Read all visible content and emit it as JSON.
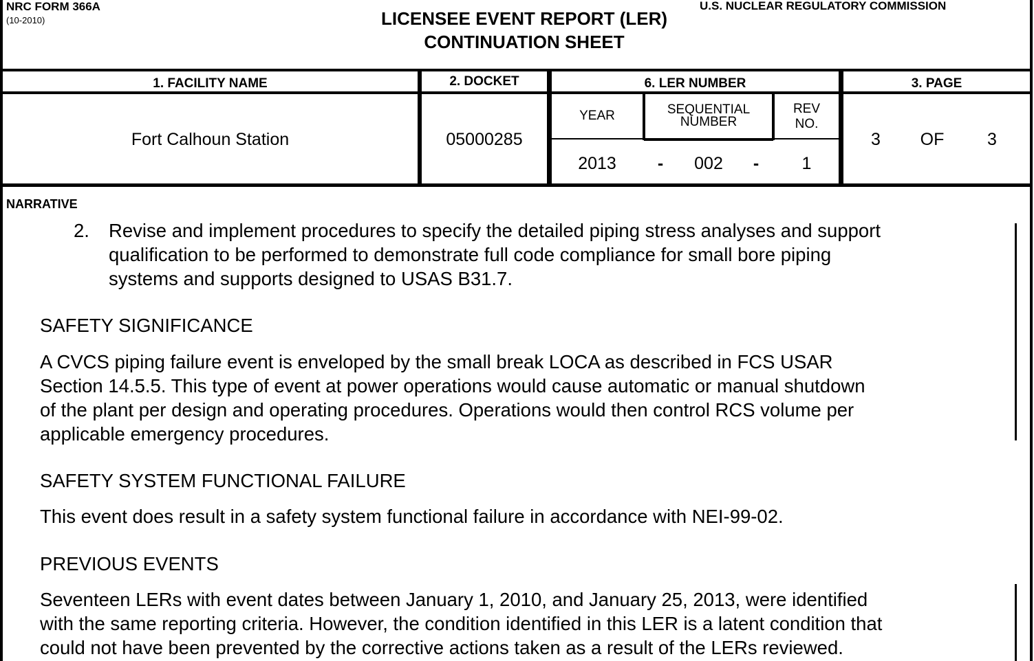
{
  "header": {
    "form_id": "NRC FORM 366A",
    "form_rev": "(10-2010)",
    "agency": "U.S. NUCLEAR REGULATORY COMMISSION",
    "title_line1": "LICENSEE EVENT REPORT (LER)",
    "title_line2": "CONTINUATION SHEET"
  },
  "fields": {
    "facility_label": "1. FACILITY NAME",
    "facility_value": "Fort Calhoun Station",
    "docket_label": "2. DOCKET",
    "docket_value": "05000285",
    "ler_label": "6. LER NUMBER",
    "year_label": "YEAR",
    "seq_label_1": "SEQUENTIAL",
    "seq_label_2": "NUMBER",
    "rev_label_1": "REV",
    "rev_label_2": "NO.",
    "year_value": "2013",
    "dash": "-",
    "seq_value": "002",
    "rev_value": "1",
    "page_label": "3. PAGE",
    "page_current": "3",
    "page_of": "OF",
    "page_total": "3"
  },
  "narrative": {
    "label": "NARRATIVE",
    "item2_number": "2.",
    "item2_lines": [
      "Revise and implement procedures to specify the detailed piping stress analyses and support",
      "qualification to be performed to demonstrate full code compliance for small bore piping",
      "systems and supports designed to USAS B31.7."
    ],
    "safety_significance_heading": "SAFETY SIGNIFICANCE",
    "safety_significance_lines": [
      "A CVCS piping failure event is enveloped by the small break LOCA as described in FCS USAR",
      "Section 14.5.5.  This type of event at power operations would cause automatic or manual shutdown",
      "of the plant per design and operating procedures.  Operations would then control RCS volume per",
      "applicable emergency procedures."
    ],
    "ssff_heading": "SAFETY SYSTEM FUNCTIONAL FAILURE",
    "ssff_lines": [
      "This event does result in a safety system functional failure in accordance with NEI-99-02."
    ],
    "previous_events_heading": "PREVIOUS EVENTS",
    "previous_events_lines": [
      "Seventeen LERs with event dates between January 1, 2010, and January 25, 2013, were identified",
      "with the same reporting criteria.  However, the condition identified in this LER is a latent condition that",
      "could not have been prevented by the corrective actions taken as a result of the LERs reviewed."
    ]
  }
}
